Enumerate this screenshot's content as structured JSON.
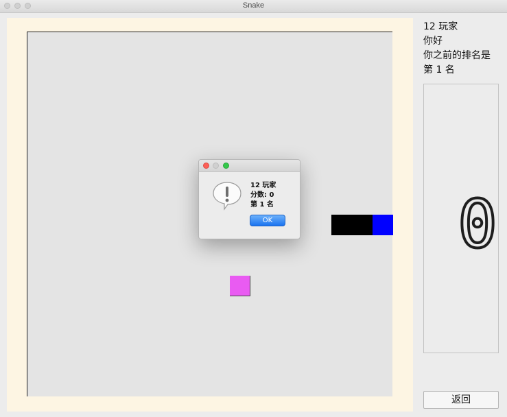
{
  "window": {
    "title": "Snake"
  },
  "sidebar": {
    "player_line": "12 玩家",
    "greeting": "你好",
    "rank_prompt": "你之前的排名是",
    "rank_value": "第 1 名",
    "score_display": "0",
    "back_label": "返回"
  },
  "dialog": {
    "line1": "12 玩家",
    "line2": "分数: 0",
    "line3": "第 1 名",
    "ok_label": "OK"
  },
  "colors": {
    "snake_head": "#0000ff",
    "snake_body": "#000000",
    "food": "#e95bf2",
    "board": "#e4e4e4",
    "board_frame": "#fdf5e3"
  }
}
